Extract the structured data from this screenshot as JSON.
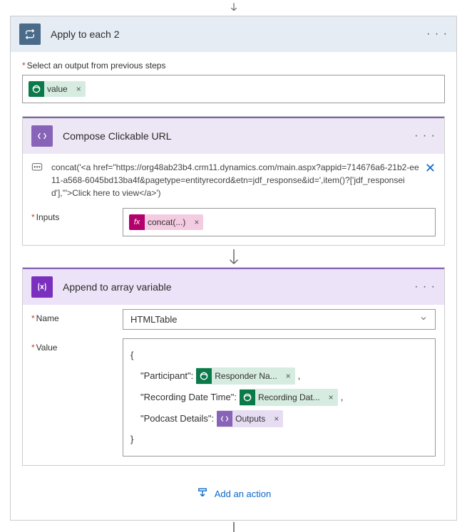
{
  "arrows": {
    "top": true,
    "mid1": true,
    "mid2": true
  },
  "applyEach": {
    "title": "Apply to each 2",
    "outputLabel": "Select an output from previous steps",
    "outputToken": "value"
  },
  "compose": {
    "title": "Compose Clickable URL",
    "expression": "concat('<a href=\"https://org48ab23b4.crm11.dynamics.com/main.aspx?appid=714676a6-21b2-ee11-a568-6045bd13ba4f&pagetype=entityrecord&etn=jdf_response&id=',item()?['jdf_responseid'],'\">Click here to view</a>')",
    "inputsLabel": "Inputs",
    "inputToken": "concat(...)"
  },
  "append": {
    "title": "Append to array variable",
    "nameLabel": "Name",
    "nameValue": "HTMLTable",
    "valueLabel": "Value",
    "json": {
      "open": "{",
      "close": "}",
      "rows": [
        {
          "key": "\"Participant\":",
          "tokenType": "green",
          "token": "Responder Na...",
          "trail": ","
        },
        {
          "key": "\"Recording Date Time\":",
          "tokenType": "green",
          "token": "Recording Dat...",
          "trail": ","
        },
        {
          "key": "\"Podcast Details\":",
          "tokenType": "purple",
          "token": "Outputs",
          "trail": ""
        }
      ]
    }
  },
  "addAction": "Add an action"
}
